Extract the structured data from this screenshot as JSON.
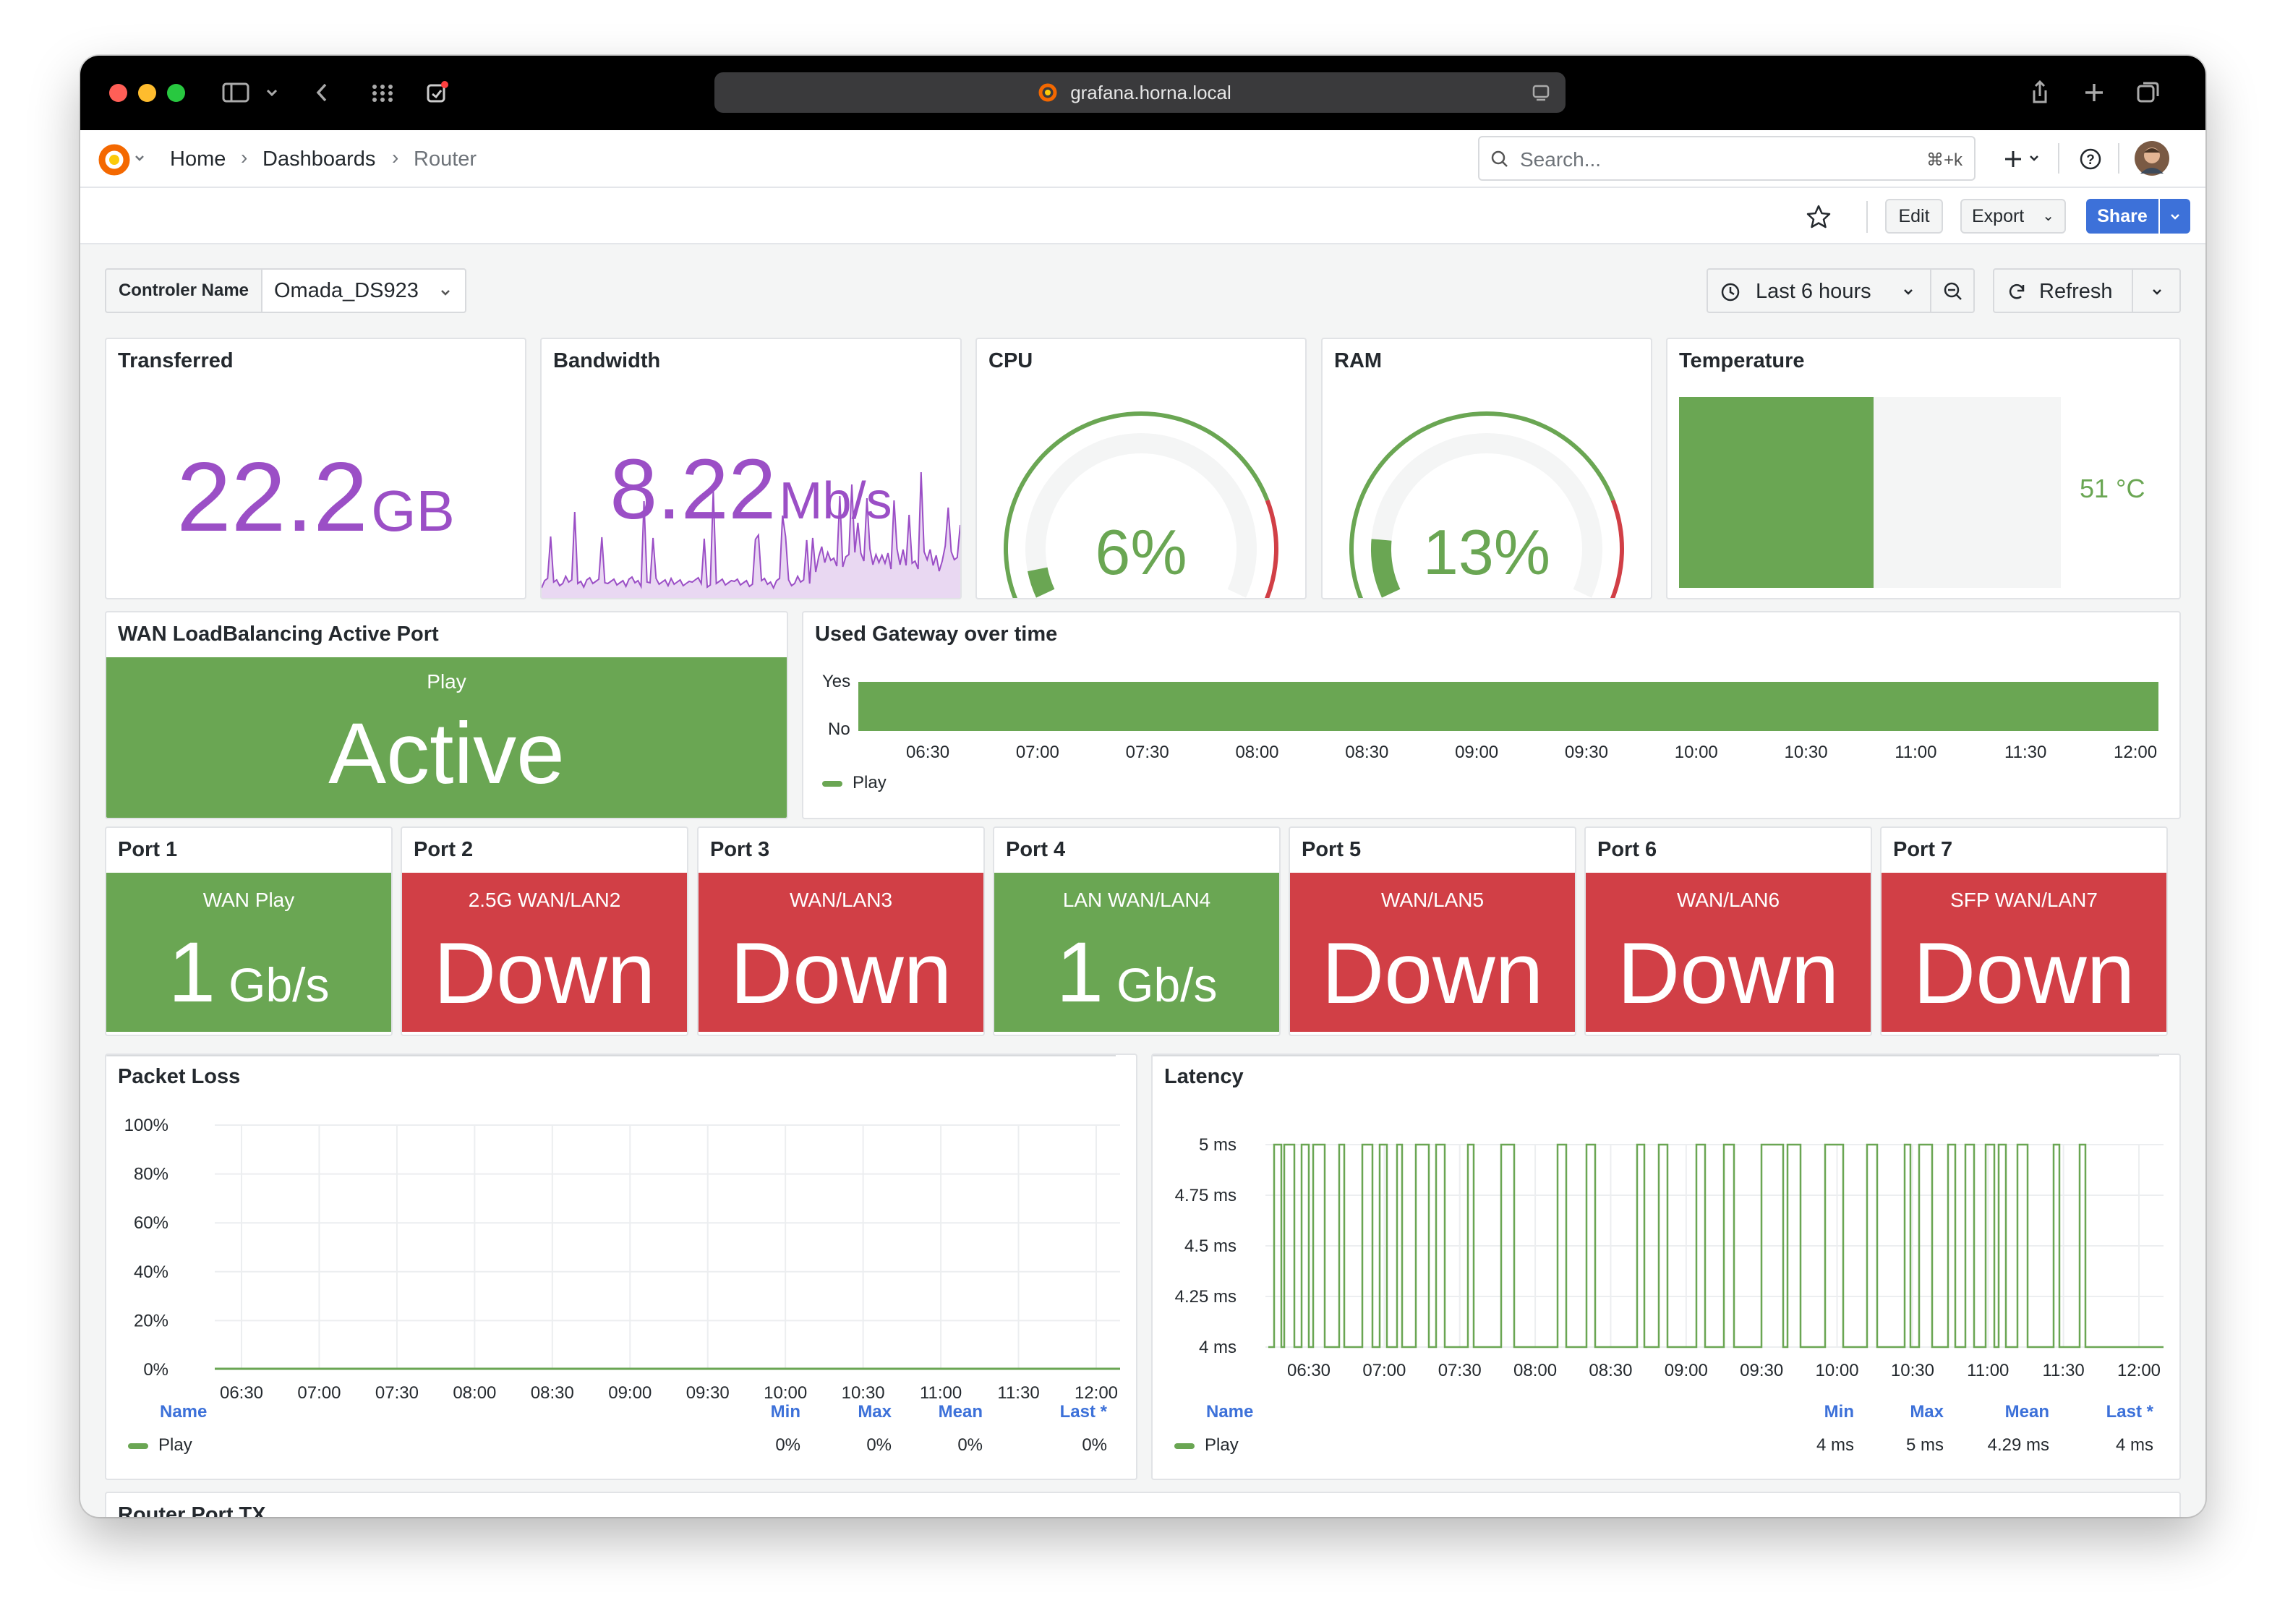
{
  "browser": {
    "url": "grafana.horna.local"
  },
  "breadcrumb": {
    "home": "Home",
    "dashboards": "Dashboards",
    "current": "Router"
  },
  "search": {
    "placeholder": "Search...",
    "shortcut": "⌘+k"
  },
  "toolbar": {
    "edit": "Edit",
    "export": "Export",
    "share": "Share"
  },
  "variables": {
    "label": "Controler Name",
    "value": "Omada_DS923"
  },
  "time": {
    "range": "Last 6 hours",
    "refresh": "Refresh"
  },
  "panels": {
    "transferred": {
      "title": "Transferred",
      "value": "22.2",
      "unit": "GB"
    },
    "bandwidth": {
      "title": "Bandwidth",
      "value": "8.22",
      "unit": "Mb/s"
    },
    "cpu": {
      "title": "CPU",
      "value": "6%",
      "percent": 6
    },
    "ram": {
      "title": "RAM",
      "value": "13%",
      "percent": 13
    },
    "temperature": {
      "title": "Temperature",
      "value": "51 °C",
      "fill_fraction": 0.51
    },
    "wan": {
      "title": "WAN LoadBalancing Active Port",
      "label": "Play",
      "value": "Active"
    },
    "gateway": {
      "title": "Used Gateway over time",
      "y_yes": "Yes",
      "y_no": "No",
      "legend": "Play"
    }
  },
  "ports": [
    {
      "title": "Port 1",
      "label": "WAN Play",
      "value": "1",
      "unit": "Gb/s",
      "status": "up"
    },
    {
      "title": "Port 2",
      "label": "2.5G WAN/LAN2",
      "value": "Down",
      "unit": "",
      "status": "down"
    },
    {
      "title": "Port 3",
      "label": "WAN/LAN3",
      "value": "Down",
      "unit": "",
      "status": "down"
    },
    {
      "title": "Port 4",
      "label": "LAN WAN/LAN4",
      "value": "1",
      "unit": "Gb/s",
      "status": "up"
    },
    {
      "title": "Port 5",
      "label": "WAN/LAN5",
      "value": "Down",
      "unit": "",
      "status": "down"
    },
    {
      "title": "Port 6",
      "label": "WAN/LAN6",
      "value": "Down",
      "unit": "",
      "status": "down"
    },
    {
      "title": "Port 7",
      "label": "SFP WAN/LAN7",
      "value": "Down",
      "unit": "",
      "status": "down"
    }
  ],
  "time_ticks": [
    "06:30",
    "07:00",
    "07:30",
    "08:00",
    "08:30",
    "09:00",
    "09:30",
    "10:00",
    "10:30",
    "11:00",
    "11:30",
    "12:00"
  ],
  "legend_headers": {
    "name": "Name",
    "min": "Min",
    "max": "Max",
    "mean": "Mean",
    "last": "Last *"
  },
  "packet_loss": {
    "title": "Packet Loss",
    "y_ticks": [
      "100%",
      "80%",
      "60%",
      "40%",
      "20%",
      "0%"
    ],
    "row": {
      "name": "Play",
      "min": "0%",
      "max": "0%",
      "mean": "0%",
      "last": "0%"
    }
  },
  "latency": {
    "title": "Latency",
    "y_ticks": [
      "5 ms",
      "4.75 ms",
      "4.5 ms",
      "4.25 ms",
      "4 ms"
    ],
    "row": {
      "name": "Play",
      "min": "4 ms",
      "max": "5 ms",
      "mean": "4.29 ms",
      "last": "4 ms"
    }
  },
  "next_panel": {
    "title": "Router Port TX"
  },
  "colors": {
    "green": "#6aa653",
    "red": "#d13f46",
    "purple": "#9b4fc6",
    "blue": "#3d71d9"
  }
}
